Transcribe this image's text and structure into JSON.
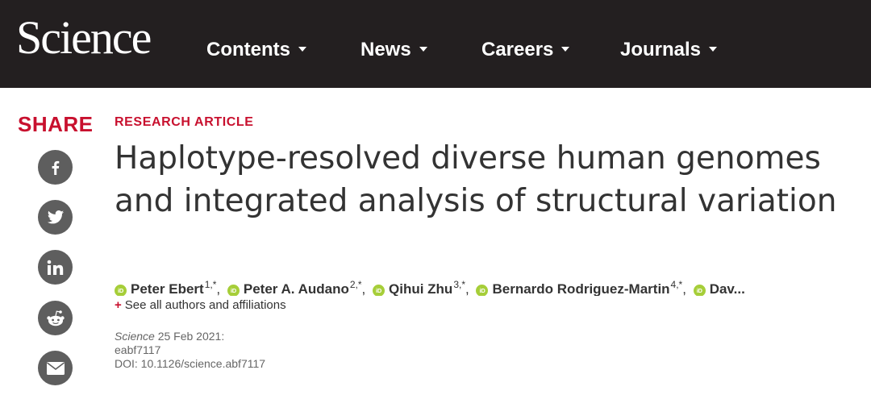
{
  "header": {
    "logo": "Science",
    "nav": [
      {
        "label": "Contents"
      },
      {
        "label": "News"
      },
      {
        "label": "Careers"
      },
      {
        "label": "Journals"
      }
    ]
  },
  "share": {
    "label": "SHARE",
    "buttons": [
      "facebook-icon",
      "twitter-icon",
      "linkedin-icon",
      "reddit-icon",
      "email-icon"
    ]
  },
  "article": {
    "type": "RESEARCH ARTICLE",
    "title": "Haplotype-resolved diverse human genomes and integrated analysis of structural variation",
    "authors": [
      {
        "name": "Peter Ebert",
        "aff": "1,*"
      },
      {
        "name": "Peter A. Audano",
        "aff": "2,*"
      },
      {
        "name": "Qihui Zhu",
        "aff": "3,*"
      },
      {
        "name": "Bernardo Rodriguez-Martin",
        "aff": "4,*"
      },
      {
        "name": "Dav...",
        "aff": ""
      }
    ],
    "orcid_label": "iD",
    "see_all": "See all authors and affiliations",
    "journal": "Science",
    "date": "25 Feb 2021:",
    "article_id": "eabf7117",
    "doi": "DOI: 10.1126/science.abf7117"
  },
  "colors": {
    "header_bg": "#231f20",
    "accent_red": "#c8102e",
    "share_gray": "#5e5e5e",
    "orcid_green": "#a6ce39"
  }
}
